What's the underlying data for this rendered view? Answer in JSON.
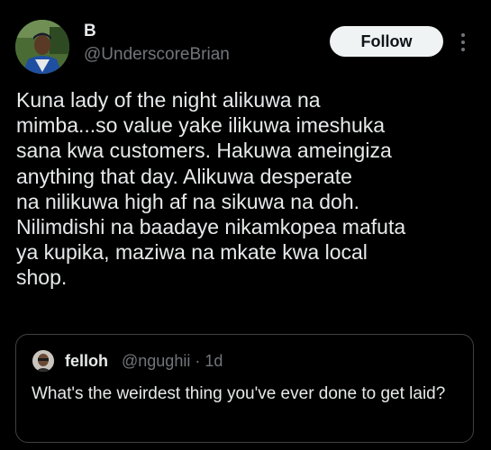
{
  "tweet": {
    "author": {
      "display_name": "B",
      "handle": "@UnderscoreBrian"
    },
    "follow_label": "Follow",
    "text": "Kuna lady of the night alikuwa na\nmimba...so value yake ilikuwa imeshuka\nsana kwa customers. Hakuwa ameingiza\nanything that day. Alikuwa desperate\nna nilikuwa high af na sikuwa na doh.\nNilimdishi na baadaye nikamkopea mafuta\nya kupika, maziwa na mkate kwa local\nshop."
  },
  "quote": {
    "display_name": "felloh",
    "handle": "@ngughii",
    "separator": "·",
    "time": "1d",
    "text": "What's the weirdest thing you've ever done to get laid?"
  },
  "icons": {
    "more": "more-vertical-icon"
  },
  "colors": {
    "background": "#000000",
    "text_primary": "#e7e9ea",
    "text_secondary": "#71767b",
    "follow_bg": "#eff3f4",
    "quote_border": "#3e4144"
  }
}
